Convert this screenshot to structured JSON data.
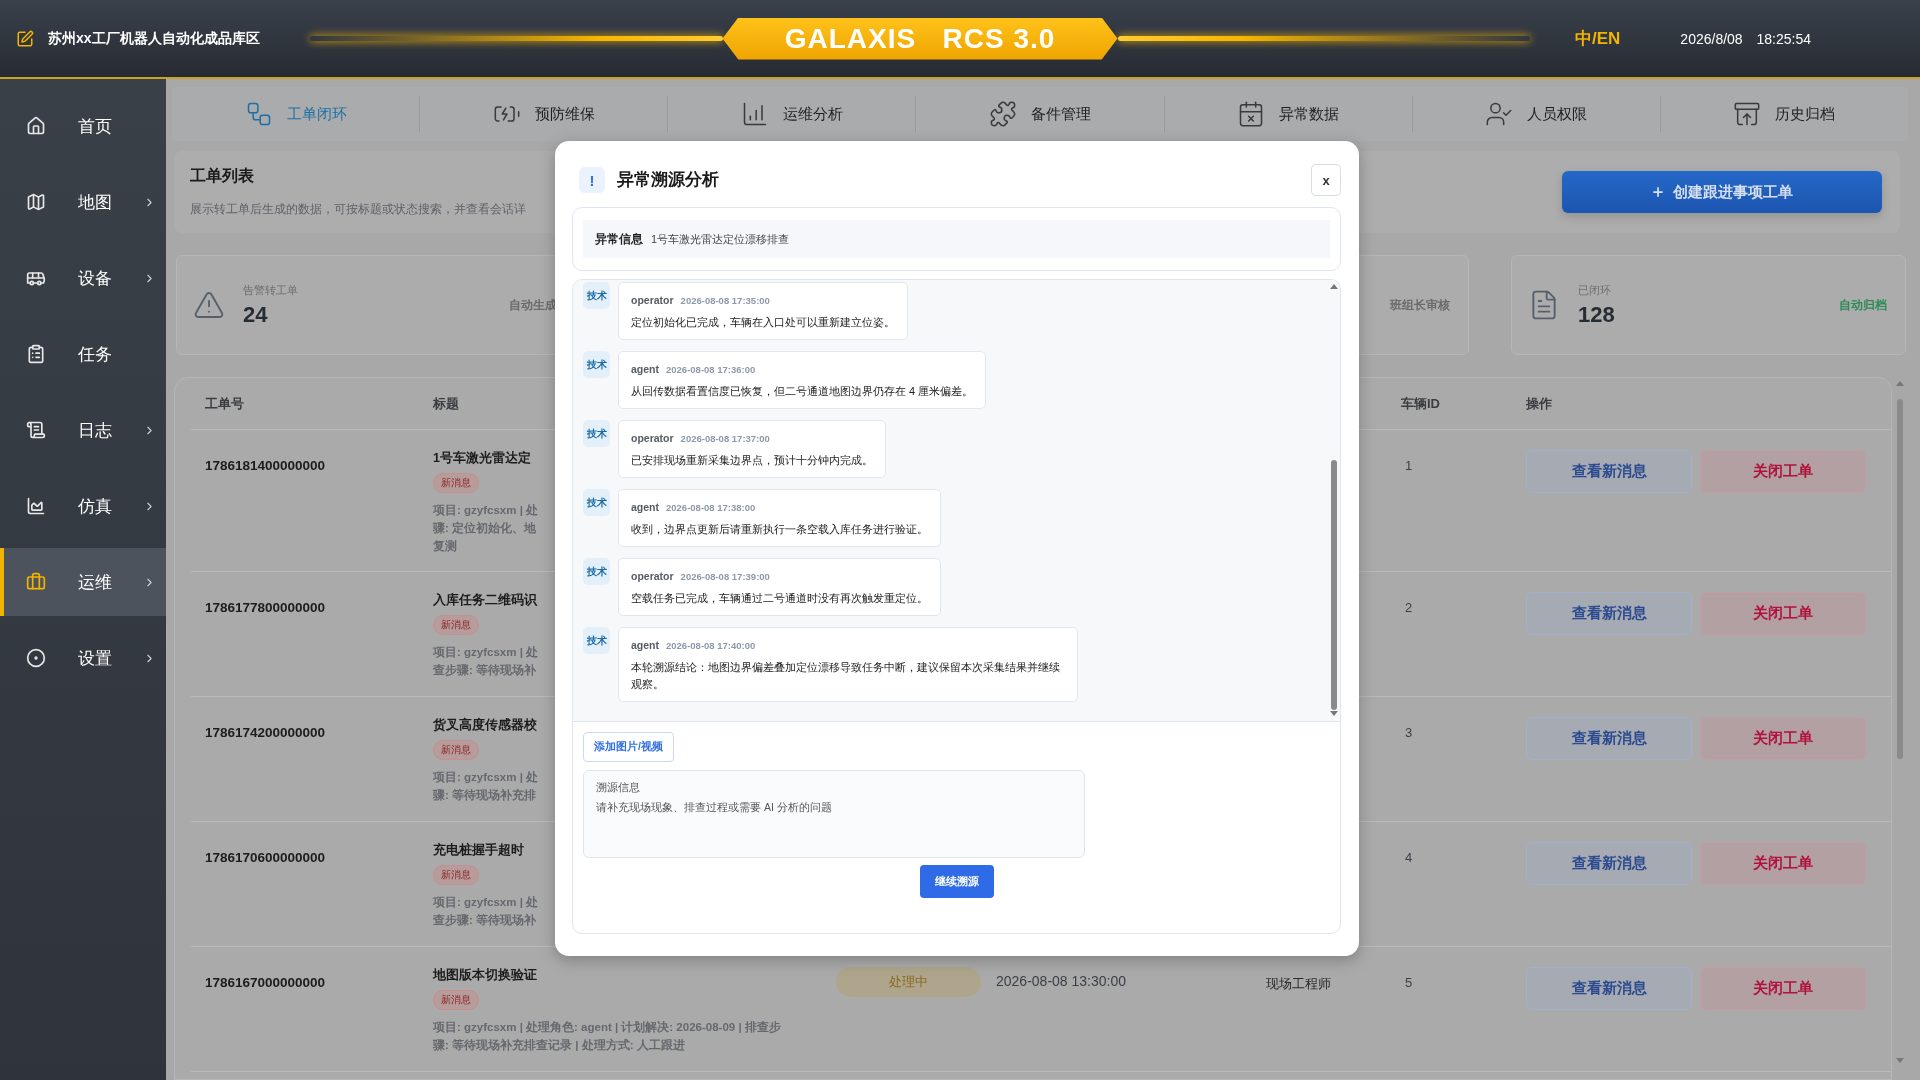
{
  "header": {
    "site_title": "苏州xx工厂机器人自动化成品库区",
    "brand": "GALAXIS   RCS 3.0",
    "language": "中/EN",
    "language_active": true,
    "datetime": "2026/8/08 18:25:54"
  },
  "sidebar": {
    "items": [
      {
        "label": "首页",
        "has_submenu": false,
        "selected": false
      },
      {
        "label": "地图",
        "has_submenu": true,
        "selected": false
      },
      {
        "label": "设备",
        "has_submenu": true,
        "selected": false
      },
      {
        "label": "任务",
        "has_submenu": false,
        "selected": false
      },
      {
        "label": "日志",
        "has_submenu": true,
        "selected": false
      },
      {
        "label": "仿真",
        "has_submenu": true,
        "selected": false
      },
      {
        "label": "运维",
        "has_submenu": true,
        "selected": true
      },
      {
        "label": "设置",
        "has_submenu": true,
        "selected": false
      }
    ]
  },
  "tabs": [
    {
      "label": "工单闭环",
      "selected": true
    },
    {
      "label": "预防维保",
      "selected": false
    },
    {
      "label": "运维分析",
      "selected": false
    },
    {
      "label": "备件管理",
      "selected": false
    },
    {
      "label": "异常数据",
      "selected": false
    },
    {
      "label": "人员权限",
      "selected": false
    },
    {
      "label": "历史归档",
      "selected": false
    }
  ],
  "page": {
    "title": "工单列表",
    "subtitle": "展示转工单后生成的数据，可按标题或状态搜索，并查看会话详",
    "create_button": "创建跟进事项工单"
  },
  "stats": [
    {
      "label": "告警转工单",
      "value": "24",
      "note": "自动生成",
      "color": "#6b6b6b"
    },
    {
      "note": "班组长审核",
      "color": "#6b6b6b"
    },
    {
      "label": "已闭环",
      "value": "128",
      "note": "自动归档",
      "color": "#2e8b57"
    }
  ],
  "table": {
    "columns": [
      "工单号",
      "标题",
      "车辆ID",
      "操作"
    ],
    "rows": [
      {
        "number": "1786181400000000",
        "title": "1号车激光雷达定",
        "badge": "新消息",
        "meta_lines": [
          "项目: gzyfcsxm | 处",
          "骤: 定位初始化、地",
          "复测"
        ],
        "vehicle_id": "1",
        "actions": [
          "查看新消息",
          "关闭工单"
        ]
      },
      {
        "number": "1786177800000000",
        "title": "入库任务二维码识",
        "badge": "新消息",
        "meta_lines": [
          "项目: gzyfcsxm | 处",
          "查步骤: 等待现场补"
        ],
        "vehicle_id": "2",
        "actions": [
          "查看新消息",
          "关闭工单"
        ]
      },
      {
        "number": "1786174200000000",
        "title": "货叉高度传感器校",
        "badge": "新消息",
        "meta_lines": [
          "项目: gzyfcsxm | 处",
          "骤: 等待现场补充排"
        ],
        "vehicle_id": "3",
        "actions": [
          "查看新消息",
          "关闭工单"
        ]
      },
      {
        "number": "1786170600000000",
        "title": "充电桩握手超时",
        "badge": "新消息",
        "meta_lines": [
          "项目: gzyfcsxm | 处",
          "查步骤: 等待现场补"
        ],
        "vehicle_id": "4",
        "actions": [
          "查看新消息",
          "关闭工单"
        ]
      },
      {
        "number": "1786167000000000",
        "title": "地图版本切换验证",
        "badge": "新消息",
        "meta_lines": [
          "项目: gzyfcsxm | 处理角色: agent | 计划解决: 2026-08-09 | 排查步",
          "骤: 等待现场补充排查记录 | 处理方式: 人工跟进"
        ],
        "status": "处理中",
        "time": "2026-08-08 13:30:00",
        "role": "现场工程师",
        "vehicle_id": "5",
        "actions": [
          "查看新消息",
          "关闭工单"
        ]
      }
    ]
  },
  "modal": {
    "icon": "!",
    "title": "异常溯源分析",
    "close": "x",
    "info_label": "异常信息",
    "info_text": "1号车激光雷达定位漂移排查",
    "messages": [
      {
        "avatar": "技术",
        "sender": "operator",
        "time": "2026-08-08 17:35:00",
        "text": "定位初始化已完成，车辆在入口处可以重新建立位姿。"
      },
      {
        "avatar": "技术",
        "sender": "agent",
        "time": "2026-08-08 17:36:00",
        "text": "从回传数据看置信度已恢复，但二号通道地图边界仍存在 4 厘米偏差。"
      },
      {
        "avatar": "技术",
        "sender": "operator",
        "time": "2026-08-08 17:37:00",
        "text": "已安排现场重新采集边界点，预计十分钟内完成。"
      },
      {
        "avatar": "技术",
        "sender": "agent",
        "time": "2026-08-08 17:38:00",
        "text": "收到，边界点更新后请重新执行一条空载入库任务进行验证。"
      },
      {
        "avatar": "技术",
        "sender": "operator",
        "time": "2026-08-08 17:39:00",
        "text": "空载任务已完成，车辆通过二号通道时没有再次触发重定位。"
      },
      {
        "avatar": "技术",
        "sender": "agent",
        "time": "2026-08-08 17:40:00",
        "text": "本轮溯源结论：地图边界偏差叠加定位漂移导致任务中断，建议保留本次采集结果并继续观察。"
      }
    ],
    "attach_button": "添加图片/视频",
    "input": {
      "label": "溯源信息",
      "placeholder": "请补充现场现象、排查过程或需要 AI 分析的问题"
    },
    "submit": "继续溯源"
  }
}
